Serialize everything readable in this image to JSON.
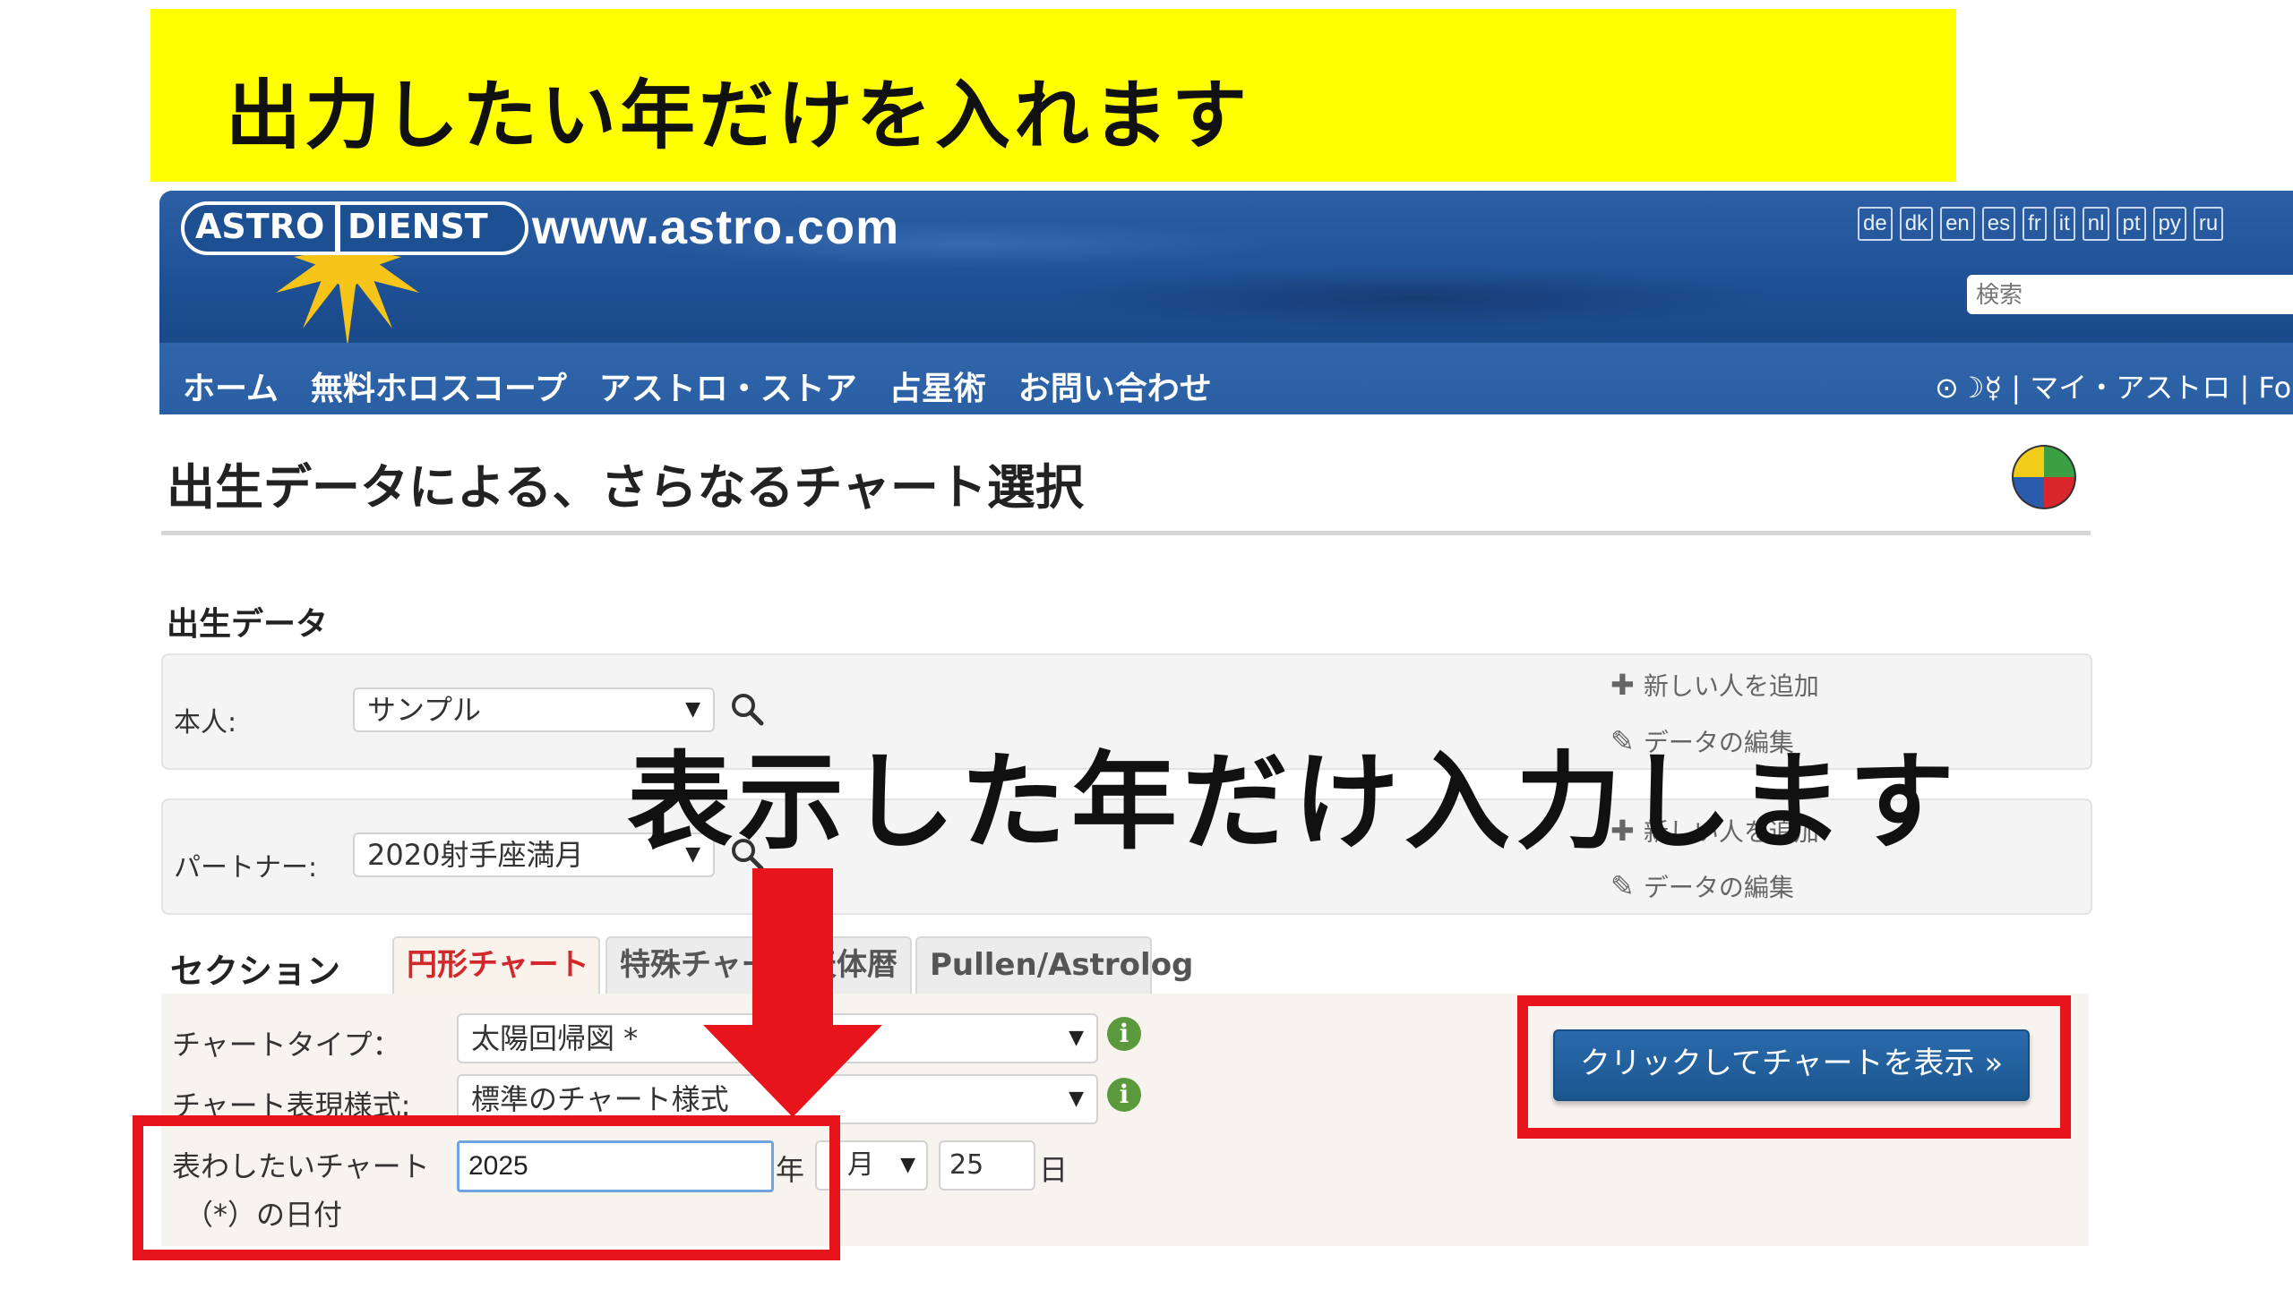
{
  "banner": {
    "text": "出力したい年だけを入れます"
  },
  "site": {
    "logo_astro": "ASTRO",
    "logo_dienst": "DIENST",
    "url": "www.astro.com",
    "languages": [
      "de",
      "dk",
      "en",
      "es",
      "fr",
      "it",
      "nl",
      "pt",
      "py",
      "ru"
    ],
    "search_placeholder": "検索",
    "nav": [
      "ホーム",
      "無料ホロスコープ",
      "アストロ・ストア",
      "占星術",
      "お問い合わせ"
    ],
    "nav_right": "⊙☽☿ | マイ・アストロ | Foru"
  },
  "page": {
    "title": "出生データによる、さらなるチャート選択"
  },
  "birth_data": {
    "heading": "出生データ",
    "self_label": "本人:",
    "self_value": "サンプル",
    "partner_label": "パートナー:",
    "partner_value": "2020射手座満月",
    "add_person": "新しい人を追加",
    "edit_data": "データの編集"
  },
  "tabs": {
    "section_label": "セクション",
    "items": [
      "円形チャート",
      "特殊チャート",
      "天体暦",
      "Pullen/Astrolog"
    ],
    "active": "円形チャート"
  },
  "form": {
    "chart_type_label": "チャートタイプ：",
    "chart_type_value": "太陽回帰図 *",
    "chart_style_label": "チャート表現様式:",
    "chart_style_value": "標準のチャート様式",
    "date_label_line1": "表わしたいチャート",
    "date_label_line2": "（*）の日付",
    "year_value": "2025",
    "year_unit": "年",
    "month_value": "",
    "month_unit": "月",
    "day_value": "25",
    "day_unit": "日",
    "info_glyph": "i"
  },
  "submit": {
    "label": "クリックしてチャートを表示 »"
  },
  "overlay": {
    "text": "表示した年だけ入力します"
  },
  "colors": {
    "banner": "#ffff00",
    "header_blue": "#1d4f93",
    "highlight_red": "#e8141b",
    "active_tab_red": "#d2282b",
    "button_blue": "#1b568f"
  }
}
